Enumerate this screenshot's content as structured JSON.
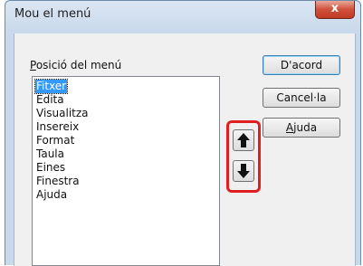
{
  "window": {
    "title": "Mou el menú",
    "close_glyph": "x"
  },
  "menu_position": {
    "label_mnemonic": "P",
    "label_rest": "osició del menú",
    "items": [
      "Fitxer",
      "Edita",
      "Visualitza",
      "Insereix",
      "Format",
      "Taula",
      "Eines",
      "Finestra",
      "Ajuda"
    ],
    "selected_index": 0
  },
  "buttons": {
    "ok": "D'acord",
    "cancel": "Cancel·la",
    "help_mnemonic": "A",
    "help_rest": "juda"
  },
  "icons": {
    "move_up": "arrow-up-icon",
    "move_down": "arrow-down-icon"
  },
  "colors": {
    "highlight": "#e02020",
    "selection": "#3399ff"
  }
}
